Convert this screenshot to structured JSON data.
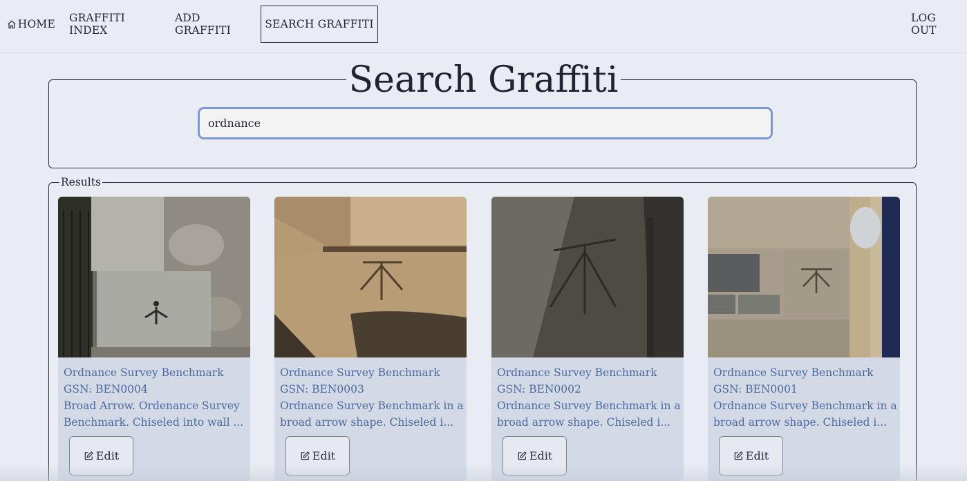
{
  "nav": {
    "home": "HOME",
    "index": "GRAFFITI INDEX",
    "add": "ADD GRAFFITI",
    "search": "SEARCH GRAFFITI",
    "logout": "LOG OUT",
    "home_icon": "home-icon"
  },
  "search": {
    "title": "Search Graffiti",
    "value": "ordnance"
  },
  "results": {
    "legend": "Results",
    "edit_label": "Edit",
    "edit_icon": "edit-square-icon",
    "cards": [
      {
        "title": "Ordnance Survey Benchmark",
        "gsn": "GSN: BEN0004",
        "desc1": "Broad Arrow. Ordenance Survey",
        "desc2": "Benchmark. Chiseled into wall ..."
      },
      {
        "title": "Ordnance Survey Benchmark",
        "gsn": "GSN: BEN0003",
        "desc1": "Ordnance Survey Benchmark in a",
        "desc2": "broad arrow shape. Chiseled i..."
      },
      {
        "title": "Ordnance Survey Benchmark",
        "gsn": "GSN: BEN0002",
        "desc1": "Ordnance Survey Benchmark in a",
        "desc2": "broad arrow shape. Chiseled i..."
      },
      {
        "title": "Ordnance Survey Benchmark",
        "gsn": "GSN: BEN0001",
        "desc1": "Ordnance Survey Benchmark in a",
        "desc2": "broad arrow shape. Chiseled i..."
      }
    ]
  },
  "colors": {
    "background": "#e9ecf3",
    "card": "#d3dae6",
    "link_text": "#4a6aa0",
    "input_focus": "#7b97d9"
  }
}
